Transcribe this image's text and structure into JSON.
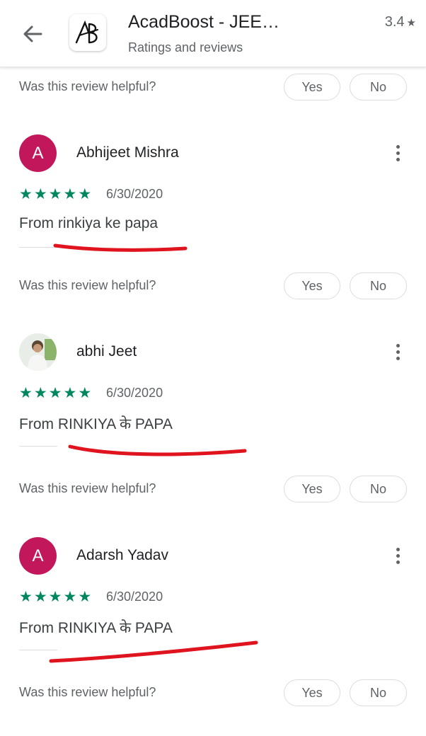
{
  "header": {
    "app_title": "AcadBoost - JEE…",
    "subtitle": "Ratings and reviews",
    "rating": "3.4",
    "icon_letters": "AB"
  },
  "helpful": {
    "question": "Was this review helpful?",
    "yes": "Yes",
    "no": "No"
  },
  "reviews": [
    {
      "author": "Abhijeet Mishra",
      "initial": "A",
      "avatar_color": "#c2185b",
      "stars": 5,
      "date": "6/30/2020",
      "text": "From rinkiya ke papa"
    },
    {
      "author": "abhi Jeet",
      "initial": "",
      "avatar_color": "#e8ece6",
      "stars": 5,
      "date": "6/30/2020",
      "text": "From RINKIYA के PAPA"
    },
    {
      "author": "Adarsh Yadav",
      "initial": "A",
      "avatar_color": "#c2185b",
      "stars": 5,
      "date": "6/30/2020",
      "text": "From RINKIYA के PAPA"
    }
  ],
  "colors": {
    "star_green": "#01875f",
    "annotation_red": "#e0141e"
  }
}
